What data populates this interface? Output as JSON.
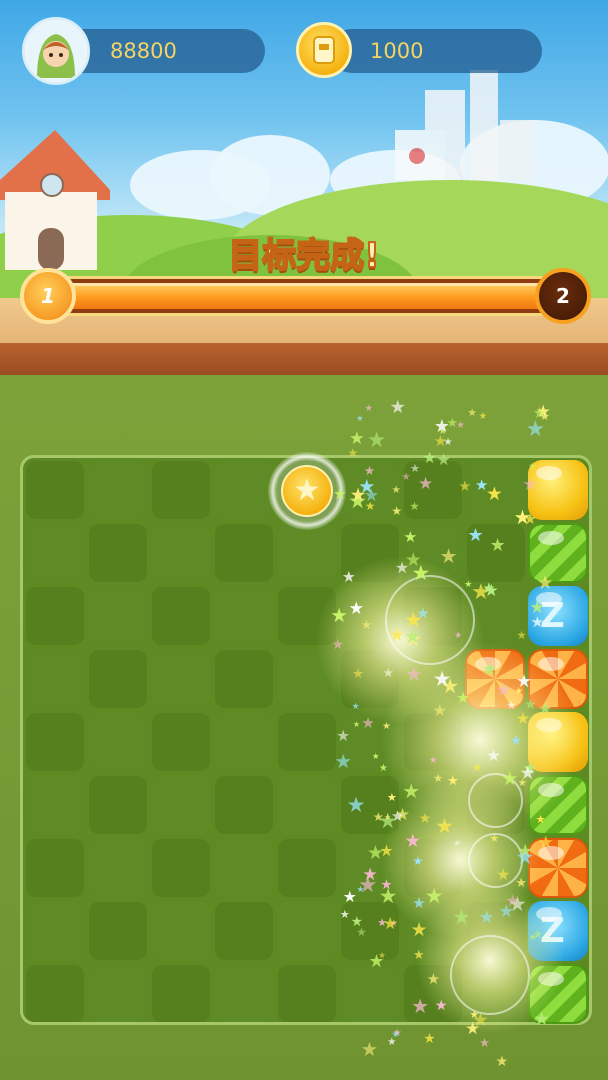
{
  "hud": {
    "score": "88800",
    "coins": "1000"
  },
  "goal": {
    "message": "目标完成!",
    "progress": 1.0,
    "current_level": "1",
    "next_level": "2"
  },
  "board": {
    "columns": 9,
    "rows": 9,
    "candies_right_column": [
      "yellow",
      "green",
      "blue",
      "orange",
      "yellow",
      "green",
      "orange",
      "blue",
      "green"
    ],
    "extra_candy": "orange",
    "star_coin": "star-icon"
  },
  "icons": {
    "avatar": "player-avatar",
    "coin": "coin-icon",
    "star": "star-icon"
  },
  "colors": {
    "hud_text": "#f5d463",
    "progress_fill": "#ff9a1e",
    "board_bg": "#5d8a22"
  }
}
